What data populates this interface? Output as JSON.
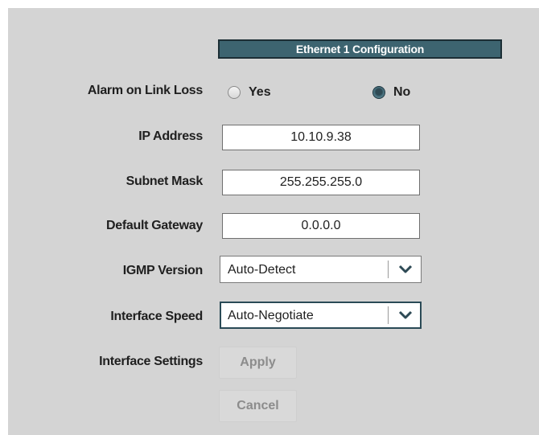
{
  "header": {
    "title": "Ethernet 1 Configuration"
  },
  "fields": {
    "alarm_on_link_loss": {
      "label": "Alarm on Link Loss",
      "options": [
        "Yes",
        "No"
      ],
      "selected": "No"
    },
    "ip_address": {
      "label": "IP Address",
      "value": "10.10.9.38"
    },
    "subnet_mask": {
      "label": "Subnet Mask",
      "value": "255.255.255.0"
    },
    "default_gateway": {
      "label": "Default Gateway",
      "value": "0.0.0.0"
    },
    "igmp_version": {
      "label": "IGMP Version",
      "value": "Auto-Detect"
    },
    "interface_speed": {
      "label": "Interface Speed",
      "value": "Auto-Negotiate"
    },
    "interface_settings": {
      "label": "Interface Settings"
    }
  },
  "buttons": {
    "apply": "Apply",
    "cancel": "Cancel"
  },
  "colors": {
    "header_bg": "#3d6470",
    "panel_bg": "#d4d4d4",
    "disabled_text": "#8c8c8c"
  },
  "icons": {
    "dropdown": "chevron-down-icon"
  }
}
